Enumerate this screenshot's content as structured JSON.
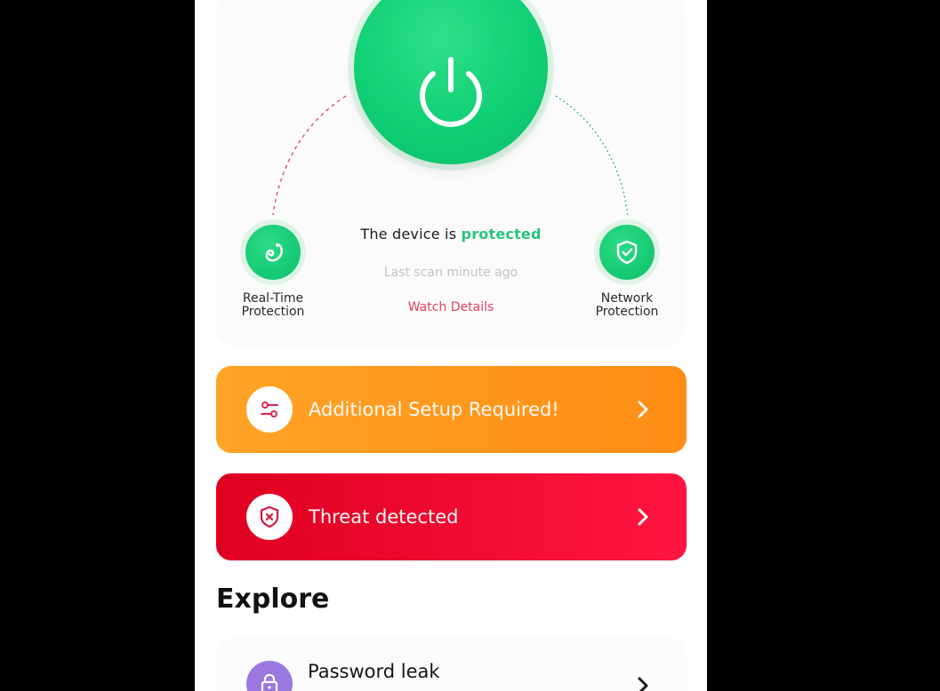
{
  "status": {
    "prefix": "The device is",
    "state": "protected",
    "scan": "Last scan minute ago",
    "details_link": "Watch Details"
  },
  "features": {
    "left": {
      "label": "Real-Time\nProtection",
      "icon": "realtime-icon"
    },
    "right": {
      "label": "Network\nProtection",
      "icon": "shield-check-icon"
    }
  },
  "alerts": {
    "setup": {
      "label": "Additional Setup Required!",
      "icon": "sliders-icon",
      "color": "#ff9a1f"
    },
    "threat": {
      "label": "Threat detected",
      "icon": "shield-x-icon",
      "color": "#f0062e"
    }
  },
  "explore": {
    "title": "Explore",
    "items": [
      {
        "title": "Password leak",
        "icon": "lock-icon"
      }
    ]
  },
  "colors": {
    "accent_green": "#10cf74",
    "link_red": "#e2405f",
    "protected_green": "#27c47c"
  }
}
